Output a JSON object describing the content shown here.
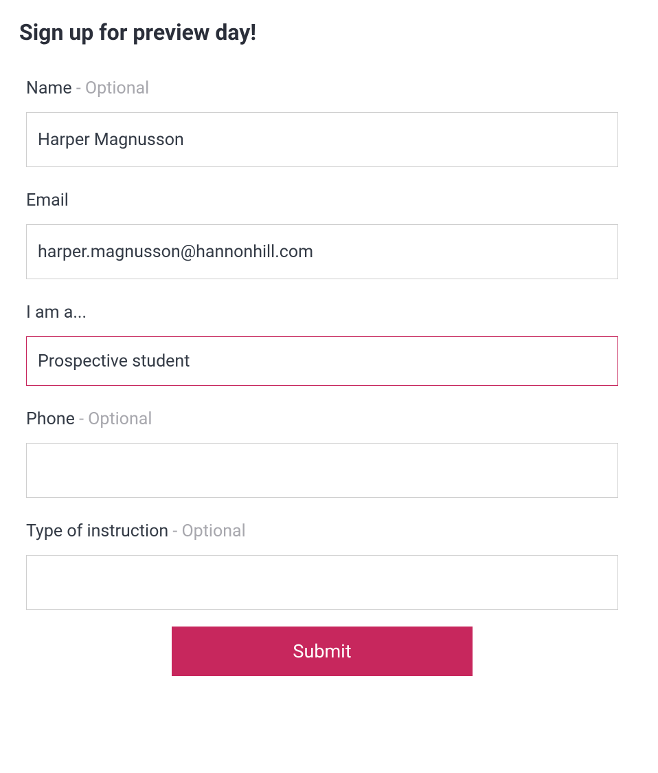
{
  "form": {
    "title": "Sign up for preview day!",
    "fields": {
      "name": {
        "label": "Name",
        "optional_suffix": " - Optional",
        "value": "Harper Magnusson"
      },
      "email": {
        "label": "Email",
        "value": "harper.magnusson@hannonhill.com"
      },
      "iam": {
        "label": "I am a...",
        "value": "Prospective student"
      },
      "phone": {
        "label": "Phone",
        "optional_suffix": " - Optional",
        "value": ""
      },
      "instruction": {
        "label": "Type of instruction",
        "optional_suffix": " - Optional",
        "value": ""
      }
    },
    "submit_label": "Submit"
  }
}
